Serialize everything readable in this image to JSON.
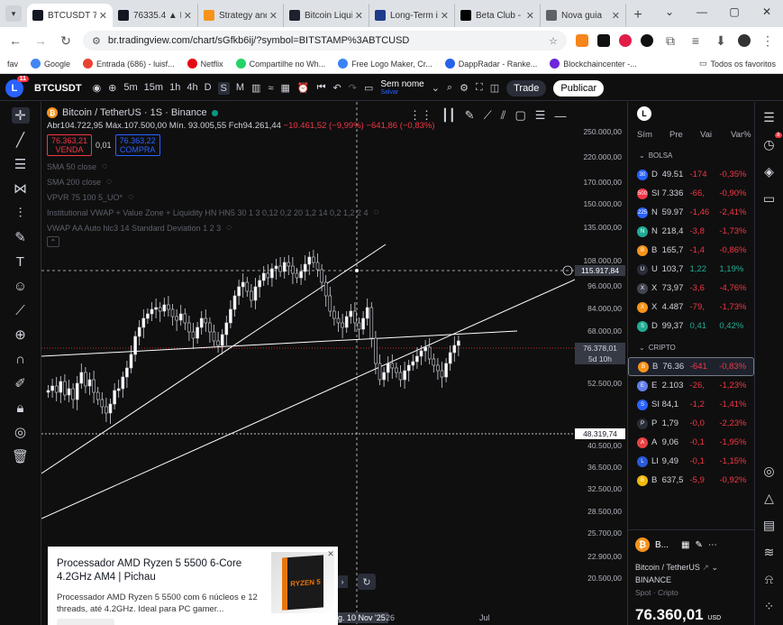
{
  "browser": {
    "tabs": [
      {
        "title": "BTCUSDT 76",
        "color": "#131722",
        "active": true
      },
      {
        "title": "76335.4 ▲ B",
        "color": "#131722",
        "active": false
      },
      {
        "title": "Strategy and",
        "color": "#f7931a",
        "active": false
      },
      {
        "title": "Bitcoin Liqui",
        "color": "#1e222d",
        "active": false
      },
      {
        "title": "Long-Term i",
        "color": "#1e3a8a",
        "active": false
      },
      {
        "title": "Beta Club - I",
        "color": "#000000",
        "active": false
      },
      {
        "title": "Nova guia",
        "color": "#5f6368",
        "active": false
      }
    ],
    "url": "br.tradingview.com/chart/sGfkb6ij/?symbol=BITSTAMP%3ABTCUSD",
    "bookmarks": [
      {
        "label": "fav",
        "color": ""
      },
      {
        "label": "Google",
        "color": "#4285f4"
      },
      {
        "label": "Entrada (686) - luisf...",
        "color": "#ea4335"
      },
      {
        "label": "Netflix",
        "color": "#e50914"
      },
      {
        "label": "Compartilhe no Wh...",
        "color": "#25d366"
      },
      {
        "label": "Free Logo Maker, Cr...",
        "color": "#3b82f6"
      },
      {
        "label": "DappRadar - Ranke...",
        "color": "#2563eb"
      },
      {
        "label": "Blockchaincenter -...",
        "color": "#6d28d9"
      }
    ],
    "all_bookmarks": "Todos os favoritos"
  },
  "tv_header": {
    "avatar_letter": "L",
    "avatar_badge": "11",
    "symbol": "BTCUSDT",
    "timeframes": [
      "5m",
      "15m",
      "1h",
      "4h",
      "D",
      "S",
      "M"
    ],
    "selected_timeframe": "S",
    "save_label": "Sem nome",
    "save_sub": "Salvar",
    "trade": "Trade",
    "publish": "Publicar"
  },
  "legend": {
    "title": "Bitcoin / TetherUS · 1S · Binance",
    "ohlc_open": "Abr104.722,95",
    "ohlc_high": "Máx.107.500,00",
    "ohlc_low": "Mín. 93.005,55",
    "ohlc_close": "Fch94.261,44",
    "ohlc_change": "−10.461,52 (−9,99%)",
    "ohlc_extra": "−641,86 (−0,83%)",
    "sell_price": "76.363,21",
    "sell_label": "VENDA",
    "spread": "0,01",
    "buy_price": "76.363,22",
    "buy_label": "COMPRA",
    "indicators": [
      "SMA 50 close",
      "SMA 200 close",
      "VPVR 75 100 5_UO*",
      "Institutional VWAP + Value Zone + Liquidity HN HN5 30 1 3 0,12 0,2 20 1,2 14 0,2 1,2 2 4",
      "VWAP AA Auto hlc3 14 Standard Deviation 1 2 3"
    ]
  },
  "price_axis": {
    "labels": [
      "250.000,00",
      "220.000,00",
      "170.000,00",
      "150.000,00",
      "135.000,00",
      "108.000,00",
      "96.000,00",
      "84.000,00",
      "68.000,00",
      "58.500,00",
      "52.500,00",
      "40.500,00",
      "36.500,00",
      "32.500,00",
      "28.500,00",
      "25.700,00",
      "22.900,00",
      "20.500,00"
    ],
    "crosshair_price": "115.917,84",
    "current_price": "76.378,01",
    "countdown": "5d 10h",
    "level_price": "48.319,74"
  },
  "time_axis": {
    "crosshair_date": "g. 10 Nov '25",
    "labels": [
      "26",
      "Jul"
    ]
  },
  "ad": {
    "title": "Processador AMD Ryzen 5 5500 6-Core 4.2GHz AM4 | Pichau",
    "description": "Processador AMD Ryzen 5 5500 com 6 núcleos e 12 threads, até 4.2GHz. Ideal para PC gamer...",
    "box_text": "RYZEN 5"
  },
  "watchlist": {
    "header_letter": "L",
    "columns": [
      "Sím",
      "Pre",
      "Vai",
      "Var%"
    ],
    "sections": [
      {
        "name": "BOLSA",
        "rows": [
          {
            "icon": "30",
            "color": "#2962ff",
            "sym": "D",
            "price": "49.51",
            "chg": "-174",
            "pct": "-0,35%",
            "up": false
          },
          {
            "icon": "500",
            "color": "#f23645",
            "sym": "SI",
            "price": "7.336",
            "chg": "-66,",
            "pct": "-0,90%",
            "up": false
          },
          {
            "icon": "225",
            "color": "#2962ff",
            "sym": "N",
            "price": "59.97",
            "chg": "-1,46",
            "pct": "-2,41%",
            "up": false
          },
          {
            "icon": "N",
            "color": "#22ab94",
            "sym": "N",
            "price": "218,4",
            "chg": "-3,8",
            "pct": "-1,73%",
            "up": false
          },
          {
            "icon": "B",
            "color": "#f7931a",
            "sym": "B",
            "price": "165,7",
            "chg": "-1,4",
            "pct": "-0,86%",
            "up": false
          },
          {
            "icon": "U",
            "color": "#2a2e39",
            "sym": "U",
            "price": "103,7",
            "chg": "1,22",
            "pct": "1,19%",
            "up": true
          },
          {
            "icon": "X",
            "color": "#434651",
            "sym": "X",
            "price": "73,97",
            "chg": "-3,6",
            "pct": "-4,76%",
            "up": false
          },
          {
            "icon": "X",
            "color": "#f7931a",
            "sym": "X",
            "price": "4.487",
            "chg": "-79,",
            "pct": "-1,73%",
            "up": false
          },
          {
            "icon": "S",
            "color": "#22ab94",
            "sym": "D",
            "price": "99,37",
            "chg": "0,41",
            "pct": "0,42%",
            "up": true
          }
        ]
      },
      {
        "name": "CRIPTO",
        "rows": [
          {
            "icon": "B",
            "color": "#f7931a",
            "sym": "B",
            "price": "76.36",
            "chg": "-641",
            "pct": "-0,83%",
            "up": false,
            "selected": true
          },
          {
            "icon": "E",
            "color": "#627eea",
            "sym": "E",
            "price": "2.103",
            "chg": "-26,",
            "pct": "-1,23%",
            "up": false
          },
          {
            "icon": "S",
            "color": "#2962ff",
            "sym": "SI",
            "price": "84,1",
            "chg": "-1,2",
            "pct": "-1,41%",
            "up": false
          },
          {
            "icon": "P",
            "color": "#2a2e39",
            "sym": "P",
            "price": "1,79",
            "chg": "-0,0",
            "pct": "-2,23%",
            "up": false
          },
          {
            "icon": "A",
            "color": "#e84142",
            "sym": "A",
            "price": "9,06",
            "chg": "-0,1",
            "pct": "-1,95%",
            "up": false
          },
          {
            "icon": "L",
            "color": "#2a5ada",
            "sym": "LI",
            "price": "9,49",
            "chg": "-0,1",
            "pct": "-1,15%",
            "up": false
          },
          {
            "icon": "B",
            "color": "#f0b90b",
            "sym": "B",
            "price": "637,5",
            "chg": "-5,9",
            "pct": "-0,92%",
            "up": false
          }
        ]
      }
    ],
    "detail": {
      "short": "B...",
      "name": "Bitcoin / TetherUS",
      "exchange": "BINANCE",
      "sub": "Spot · Cripto",
      "price": "76.360,01",
      "currency": "USD"
    }
  },
  "right_sidebar_badge": "8"
}
